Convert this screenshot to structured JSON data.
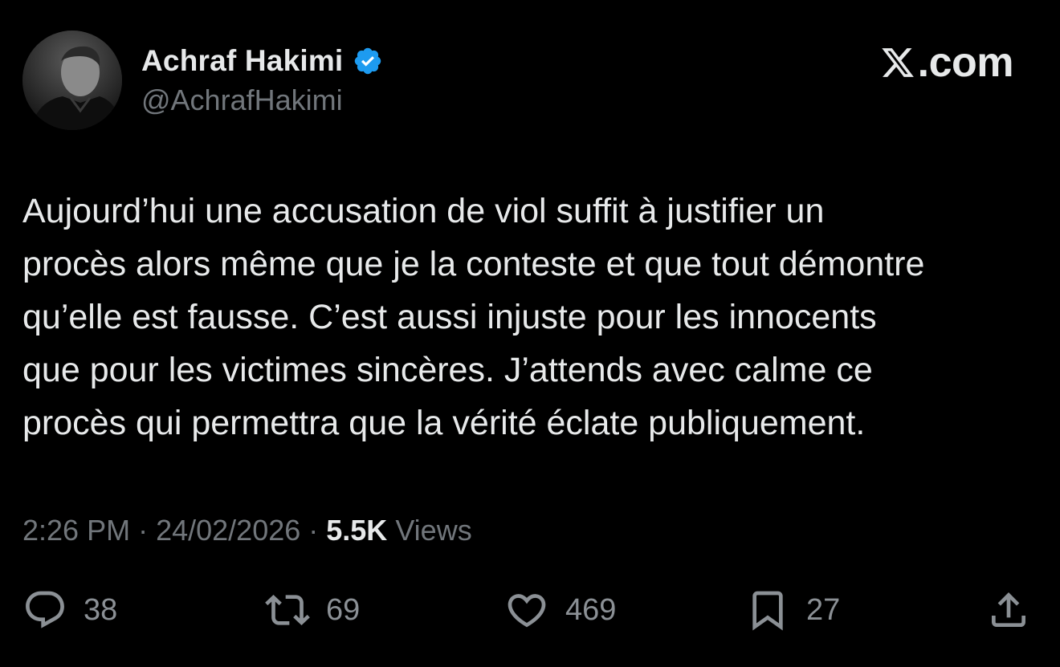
{
  "author": {
    "display_name": "Achraf Hakimi",
    "handle": "@AchrafHakimi",
    "verified": true,
    "verified_color": "#1d9bf0"
  },
  "brand": {
    "label": ".com",
    "icon": "x-logo-icon"
  },
  "tweet": {
    "text": "Aujourd’hui une accusation de viol suffit à justifier un\nprocès alors même que je la conteste et que tout démontre\nqu’elle est fausse. C’est aussi injuste pour les innocents\nque pour les victimes sincères. J’attends avec calme ce\nprocès qui permettra que la vérité éclate publiquement."
  },
  "meta": {
    "time": "2:26 PM",
    "separator": "·",
    "date": "24/02/2026",
    "views_count": "5.5K",
    "views_label": "Views"
  },
  "actions": {
    "replies": {
      "icon": "reply-icon",
      "count": "38"
    },
    "reposts": {
      "icon": "repost-icon",
      "count": "69"
    },
    "likes": {
      "icon": "heart-icon",
      "count": "469"
    },
    "bookmarks": {
      "icon": "bookmark-icon",
      "count": "27"
    },
    "share": {
      "icon": "share-icon"
    }
  },
  "colors": {
    "background": "#000000",
    "primary_text": "#e7e9ea",
    "secondary_text": "#71767b"
  }
}
